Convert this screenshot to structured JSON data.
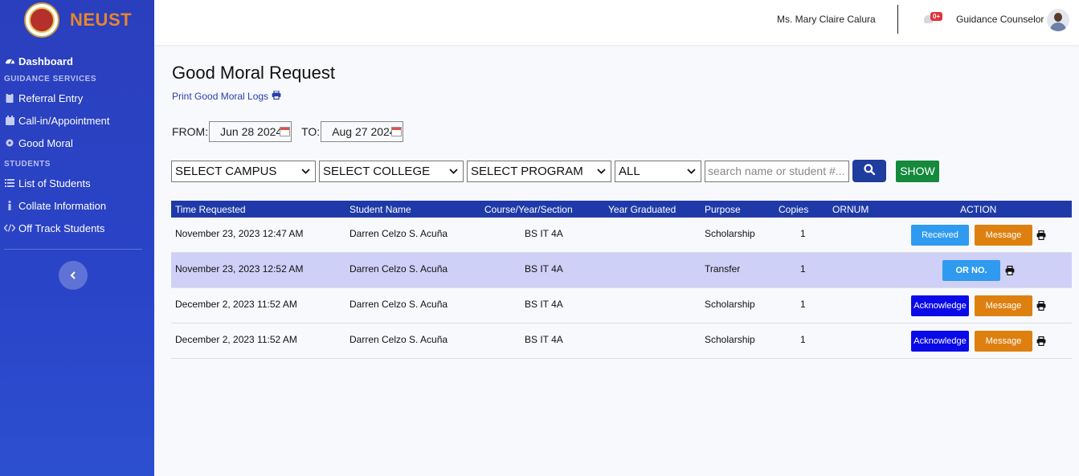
{
  "brand": {
    "name": "NEUST"
  },
  "sidebar": {
    "dashboard": "Dashboard",
    "section_guidance": "GUIDANCE SERVICES",
    "guidance_items": [
      {
        "label": "Referral Entry",
        "icon": "clipboard-icon"
      },
      {
        "label": "Call-in/Appointment",
        "icon": "calendar-icon"
      },
      {
        "label": "Good Moral",
        "icon": "gear-icon"
      }
    ],
    "section_students": "STUDENTS",
    "student_items": [
      {
        "label": "List of Students",
        "icon": "list-icon"
      },
      {
        "label": "Collate Information",
        "icon": "info-icon"
      },
      {
        "label": "Off Track Students",
        "icon": "code-icon"
      }
    ]
  },
  "topbar": {
    "user_name": "Ms. Mary Claire Calura",
    "notification_count": "0+",
    "role": "Guidance Counselor"
  },
  "page": {
    "title": "Good Moral Request",
    "print_logs": "Print Good Moral Logs"
  },
  "dates": {
    "from_label": "FROM:",
    "from_value": "Jun 28 2024",
    "to_label": "TO:",
    "to_value": "Aug 27 2024"
  },
  "filters": {
    "campus": "SELECT CAMPUS",
    "college": "SELECT COLLEGE",
    "program": "SELECT PROGRAM",
    "status": "ALL",
    "search_placeholder": "search name or student #...",
    "show_label": "SHOW"
  },
  "table": {
    "headers": [
      "Time Requested",
      "Student Name",
      "Course/Year/Section",
      "Year Graduated",
      "Purpose",
      "Copies",
      "ORNUM",
      "ACTION"
    ],
    "rows": [
      {
        "time": "November 23, 2023 12:47 AM",
        "name": "Darren Celzo S. Acuña",
        "course": "BS IT 4A",
        "year_graduated": "",
        "purpose": "Scholarship",
        "copies": "1",
        "ornum": "",
        "primary_action": "Received",
        "secondary_action": "Message"
      },
      {
        "time": "November 23, 2023 12:52 AM",
        "name": "Darren Celzo S. Acuña",
        "course": "BS IT 4A",
        "year_graduated": "",
        "purpose": "Transfer",
        "copies": "1",
        "ornum": "",
        "primary_action": "OR NO.",
        "secondary_action": ""
      },
      {
        "time": "December 2, 2023 11:52 AM",
        "name": "Darren Celzo S. Acuña",
        "course": "BS IT 4A",
        "year_graduated": "",
        "purpose": "Scholarship",
        "copies": "1",
        "ornum": "",
        "primary_action": "Acknowledge",
        "secondary_action": "Message"
      },
      {
        "time": "December 2, 2023 11:52 AM",
        "name": "Darren Celzo S. Acuña",
        "course": "BS IT 4A",
        "year_graduated": "",
        "purpose": "Scholarship",
        "copies": "1",
        "ornum": "",
        "primary_action": "Acknowledge",
        "secondary_action": "Message"
      }
    ]
  },
  "colors": {
    "sidebar": "#2a3fbd",
    "brand_text": "#e8852c",
    "table_header": "#1f3aa8",
    "received": "#2f9bf0",
    "message": "#dd8010",
    "acknowledge": "#0a0ae8",
    "show": "#15893c",
    "highlight_row": "#cfd0f8"
  }
}
